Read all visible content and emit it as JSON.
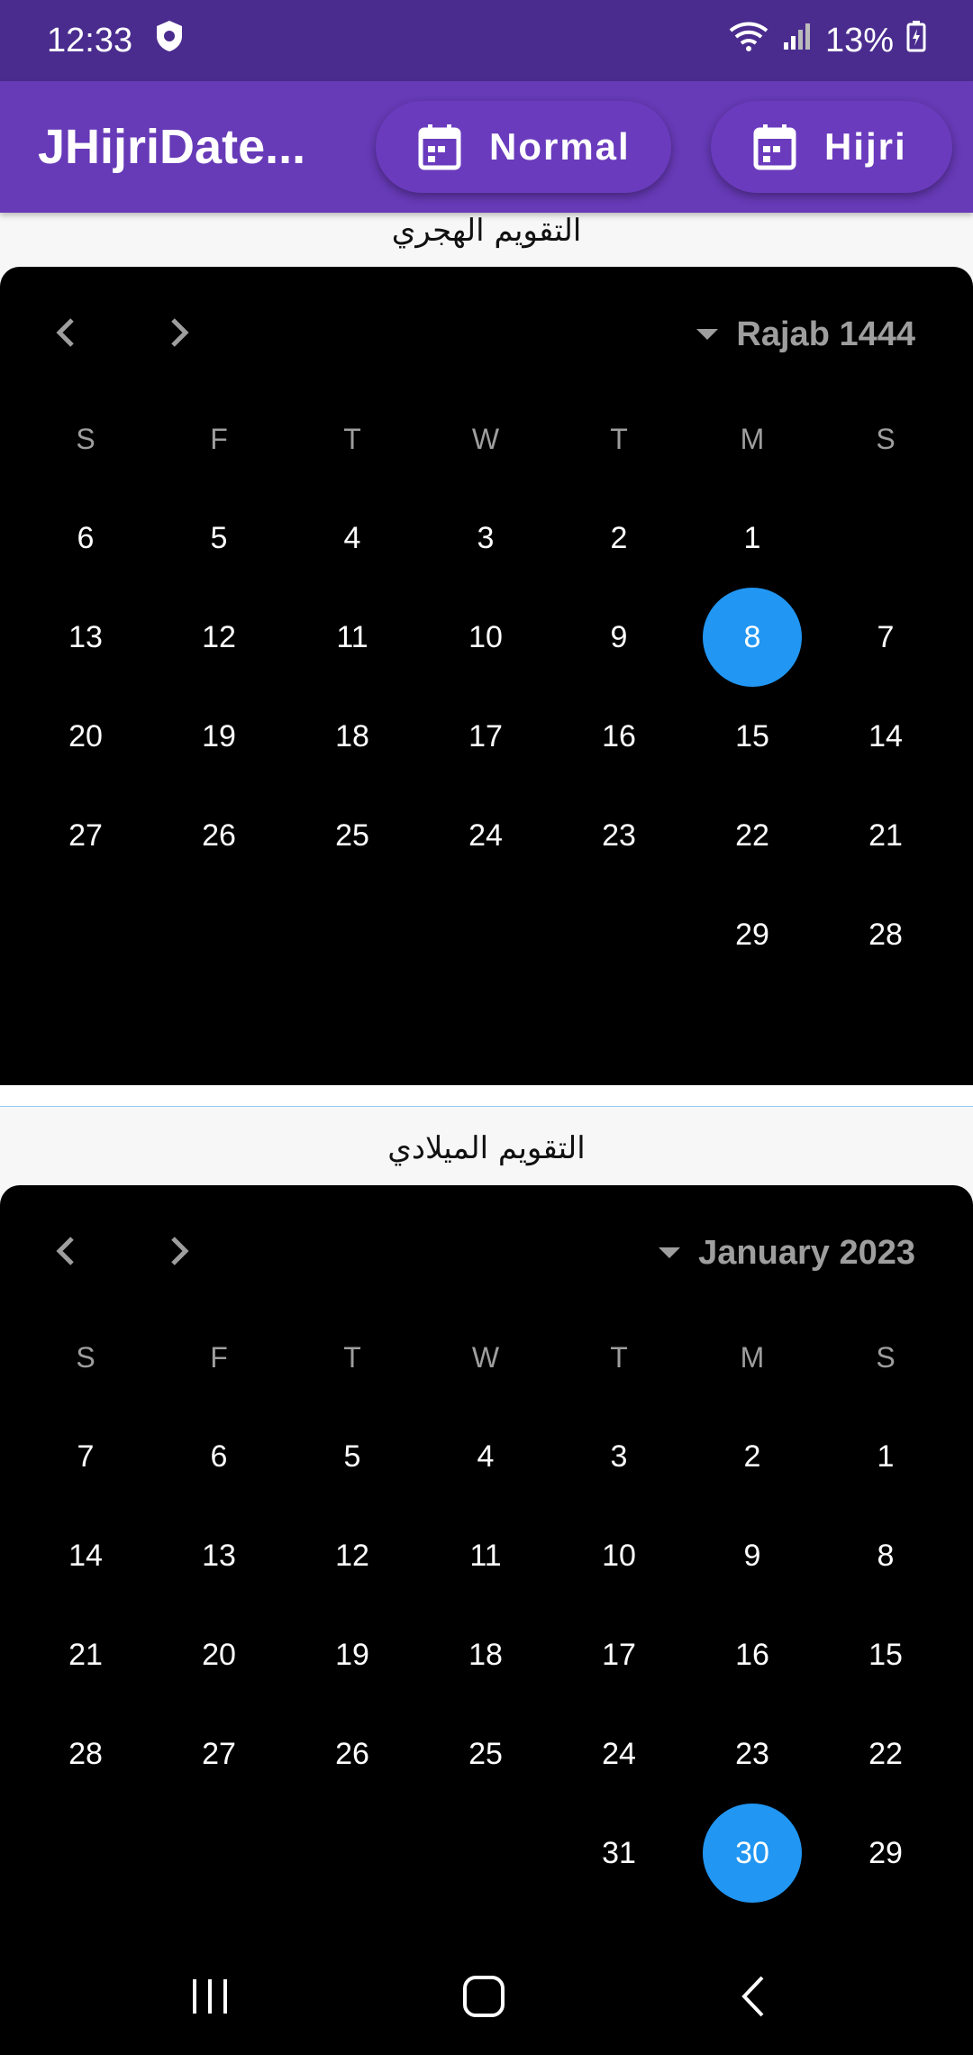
{
  "status_bar": {
    "time": "12:33",
    "battery": "13%",
    "icons": [
      "shield-icon",
      "wifi-icon",
      "signal-icon",
      "battery-charging-icon"
    ]
  },
  "app_bar": {
    "title": "JHijriDate...",
    "normal_button": "Normal",
    "hijri_button": "Hijri",
    "color": "#673ab7"
  },
  "hijri_calendar": {
    "section_title": "التقويم الهجري",
    "month_label": "Rajab 1444",
    "weekday_headers": [
      "S",
      "F",
      "T",
      "W",
      "T",
      "M",
      "S"
    ],
    "weeks": [
      [
        "6",
        "5",
        "4",
        "3",
        "2",
        "1",
        ""
      ],
      [
        "13",
        "12",
        "11",
        "10",
        "9",
        "8",
        "7"
      ],
      [
        "20",
        "19",
        "18",
        "17",
        "16",
        "15",
        "14"
      ],
      [
        "27",
        "26",
        "25",
        "24",
        "23",
        "22",
        "21"
      ],
      [
        "",
        "",
        "",
        "",
        "",
        "29",
        "28"
      ]
    ],
    "selected_day": "8"
  },
  "gregorian_calendar": {
    "section_title": "التقويم الميلادي",
    "month_label": "January 2023",
    "weekday_headers": [
      "S",
      "F",
      "T",
      "W",
      "T",
      "M",
      "S"
    ],
    "weeks": [
      [
        "7",
        "6",
        "5",
        "4",
        "3",
        "2",
        "1"
      ],
      [
        "14",
        "13",
        "12",
        "11",
        "10",
        "9",
        "8"
      ],
      [
        "21",
        "20",
        "19",
        "18",
        "17",
        "16",
        "15"
      ],
      [
        "28",
        "27",
        "26",
        "25",
        "24",
        "23",
        "22"
      ],
      [
        "",
        "",
        "",
        "",
        "31",
        "30",
        "29"
      ]
    ],
    "selected_day": "30"
  },
  "colors": {
    "selection": "#2196f3",
    "calendar_bg": "#000000",
    "status_bar": "#4a2c8e"
  }
}
